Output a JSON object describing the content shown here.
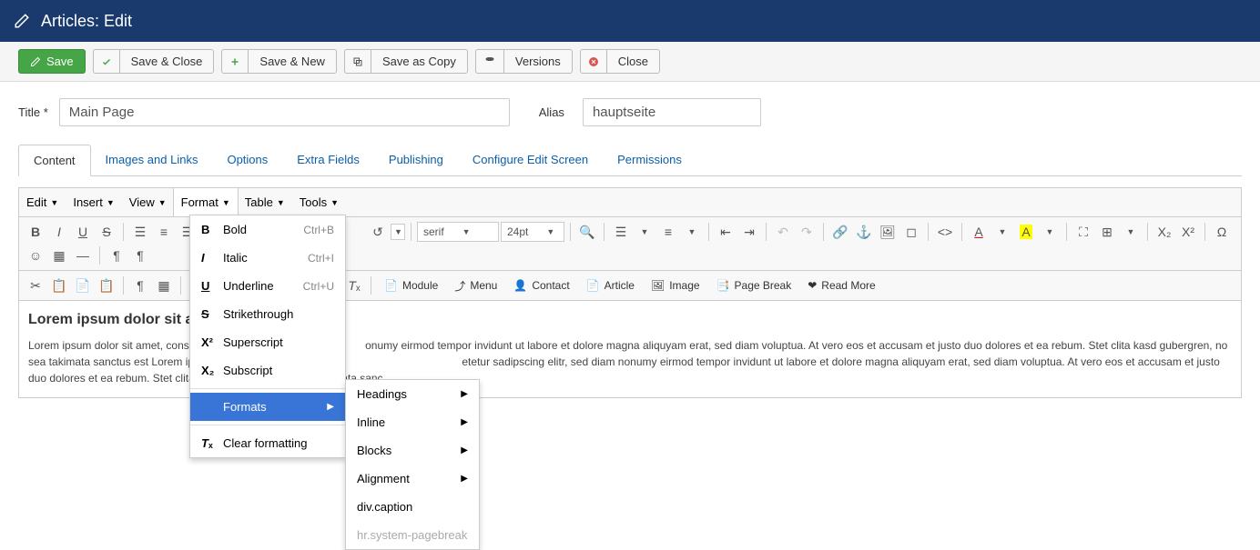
{
  "header": {
    "title": "Articles: Edit"
  },
  "toolbar": {
    "save": "Save",
    "save_close": "Save & Close",
    "save_new": "Save & New",
    "save_copy": "Save as Copy",
    "versions": "Versions",
    "close": "Close"
  },
  "form": {
    "title_label": "Title *",
    "title_value": "Main Page",
    "alias_label": "Alias",
    "alias_value": "hauptseite"
  },
  "tabs": [
    "Content",
    "Images and Links",
    "Options",
    "Extra Fields",
    "Publishing",
    "Configure Edit Screen",
    "Permissions"
  ],
  "menubar": [
    "Edit",
    "Insert",
    "View",
    "Format",
    "Table",
    "Tools"
  ],
  "font_family": "serif",
  "font_size": "24pt",
  "secondary_buttons": {
    "module": "Module",
    "menu": "Menu",
    "contact": "Contact",
    "article": "Article",
    "image": "Image",
    "page_break": "Page Break",
    "read_more": "Read More"
  },
  "content": {
    "heading": "Lorem ipsum dolor sit a",
    "body": "Lorem ipsum dolor sit amet, cons                                                          onumy eirmod tempor invidunt ut labore et dolore magna aliquyam erat, sed diam voluptua. At vero eos et accusam et justo duo dolores et ea rebum. Stet clita kasd gubergren, no sea takimata sanctus est Lorem ipsum dolor sit amet. L                                                       etetur sadipscing elitr, sed diam nonumy eirmod tempor invidunt ut labore et dolore magna aliquyam erat, sed diam voluptua. At vero eos et accusam et justo duo dolores et ea rebum. Stet clita kasd gubergren, no sea takimata sanc"
  },
  "format_menu": {
    "bold": "Bold",
    "bold_sc": "Ctrl+B",
    "italic": "Italic",
    "italic_sc": "Ctrl+I",
    "underline": "Underline",
    "underline_sc": "Ctrl+U",
    "strike": "Strikethrough",
    "sup": "Superscript",
    "sub": "Subscript",
    "formats": "Formats",
    "clear": "Clear formatting"
  },
  "formats_submenu": {
    "headings": "Headings",
    "inline": "Inline",
    "blocks": "Blocks",
    "alignment": "Alignment",
    "divcaption": "div.caption",
    "hr": "hr.system-pagebreak"
  }
}
